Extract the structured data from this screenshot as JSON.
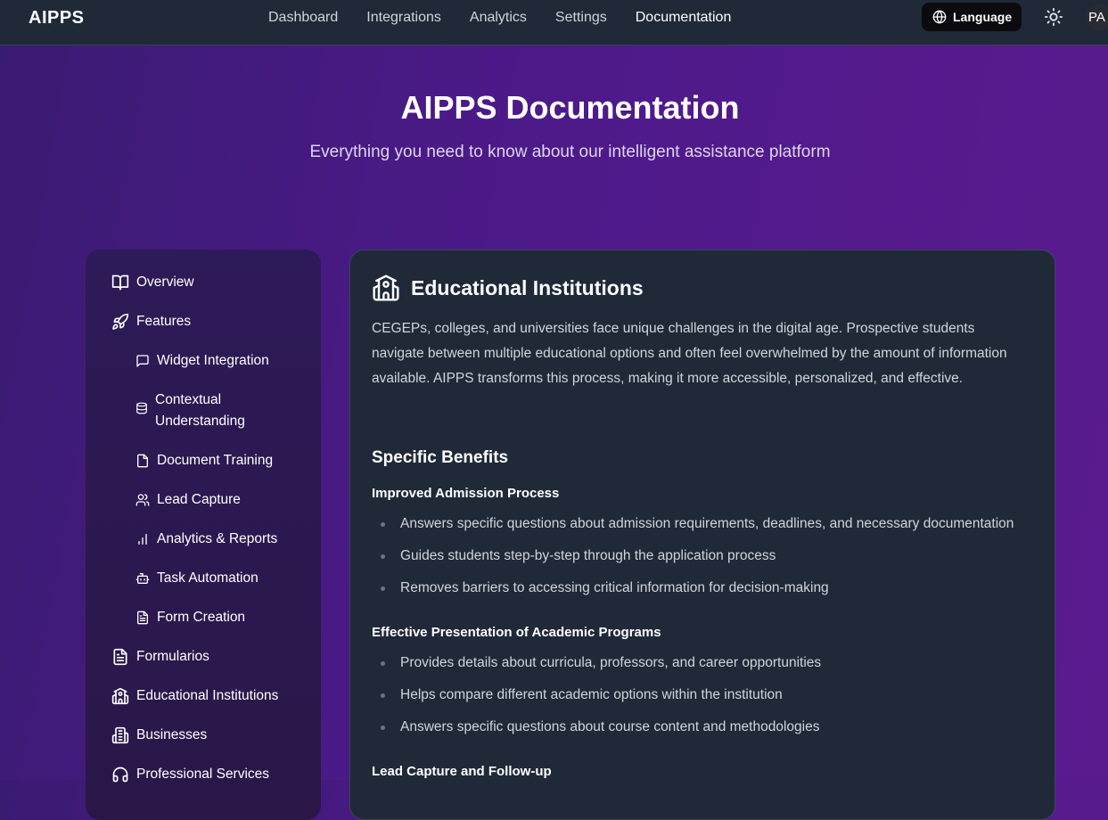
{
  "app": {
    "brand": "AIPPS"
  },
  "nav": {
    "items": [
      {
        "label": "Dashboard"
      },
      {
        "label": "Integrations"
      },
      {
        "label": "Analytics"
      },
      {
        "label": "Settings"
      },
      {
        "label": "Documentation",
        "active": true
      }
    ],
    "language_label": "Language",
    "language_icon": "globe-icon",
    "theme_icon": "sun-icon",
    "avatar_initials": "PA"
  },
  "hero": {
    "title": "AIPPS Documentation",
    "subtitle": "Everything you need to know about our intelligent assistance platform"
  },
  "sidebar": {
    "items": [
      {
        "label": "Overview",
        "icon": "book-open-icon"
      },
      {
        "label": "Features",
        "icon": "rocket-icon"
      },
      {
        "label": "Widget Integration",
        "icon": "message-square-icon"
      },
      {
        "label": "Contextual Understanding",
        "icon": "database-icon"
      },
      {
        "label": "Document Training",
        "icon": "file-icon"
      },
      {
        "label": "Lead Capture",
        "icon": "users-icon"
      },
      {
        "label": "Analytics & Reports",
        "icon": "bar-chart-icon"
      },
      {
        "label": "Task Automation",
        "icon": "bot-icon"
      },
      {
        "label": "Form Creation",
        "icon": "file-text-icon"
      },
      {
        "label": "Formularios",
        "icon": "file-text-icon"
      },
      {
        "label": "Educational Institutions",
        "icon": "school-icon"
      },
      {
        "label": "Businesses",
        "icon": "building-icon"
      },
      {
        "label": "Professional Services",
        "icon": "headphones-icon"
      }
    ]
  },
  "main": {
    "section_title": "Educational Institutions",
    "section_icon": "school-icon",
    "intro": "CEGEPs, colleges, and universities face unique challenges in the digital age. Prospective students navigate between multiple educational options and often feel overwhelmed by the amount of information available. AIPPS transforms this process, making it more accessible, personalized, and effective.",
    "benefits_heading": "Specific Benefits",
    "groups": [
      {
        "title": "Improved Admission Process",
        "items": [
          "Answers specific questions about admission requirements, deadlines, and necessary documentation",
          "Guides students step-by-step through the application process",
          "Removes barriers to accessing critical information for decision-making"
        ]
      },
      {
        "title": "Effective Presentation of Academic Programs",
        "items": [
          "Provides details about curricula, professors, and career opportunities",
          "Helps compare different academic options within the institution",
          "Answers specific questions about course content and methodologies"
        ]
      },
      {
        "title": "Lead Capture and Follow-up",
        "items": []
      }
    ]
  }
}
